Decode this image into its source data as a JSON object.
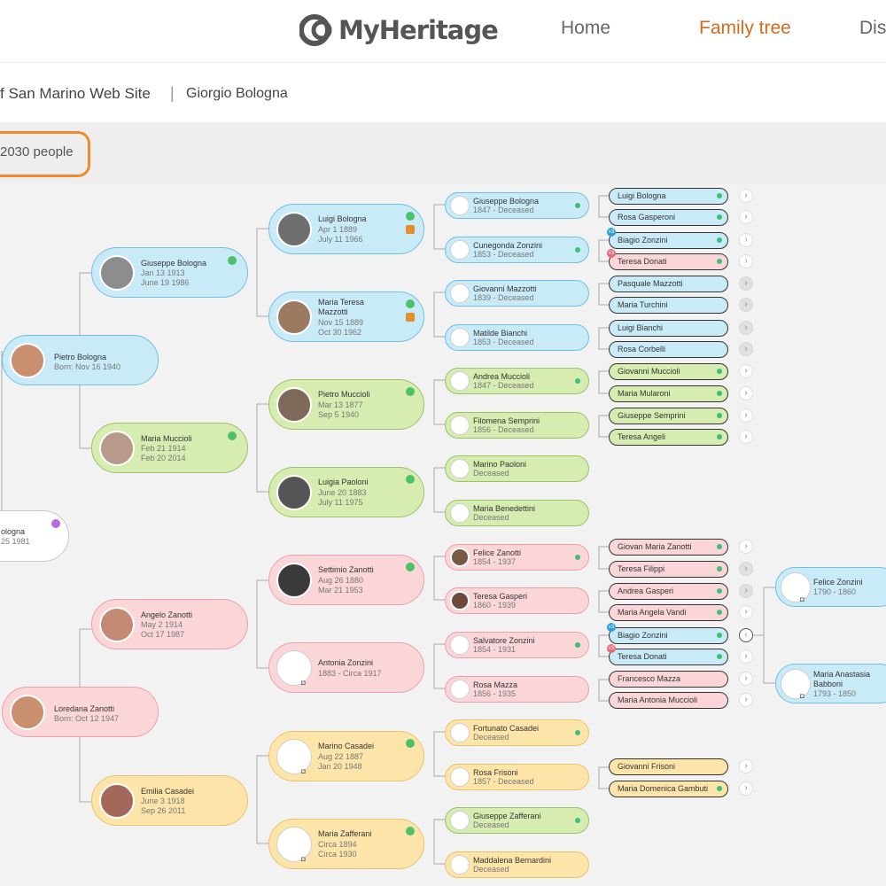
{
  "logo": {
    "text": "MyHeritage",
    "color": "#555555"
  },
  "nav": {
    "home": "Home",
    "family_tree": "Family tree",
    "discover": "Dis"
  },
  "breadcrumb": {
    "site": "f San Marino Web Site",
    "separator": "|",
    "person": "Giorgio Bologna"
  },
  "tree": {
    "people_count": "2030 people"
  },
  "colors": {
    "blue": "#c9ebf8",
    "pink": "#fbd6d9",
    "green": "#d6ecb0",
    "yellow": "#fde5a9",
    "accent": "#d36b1e",
    "highlight": "#f08a2a"
  },
  "root": {
    "name": "ologna",
    "dates": "25 1981"
  },
  "gen1": [
    {
      "name": "Pietro Bologna",
      "d1": "Born: Nov 16 1940",
      "color": "blue"
    },
    {
      "name": "Loredana Zanotti",
      "d1": "Born: Oct 12 1947",
      "color": "pink"
    }
  ],
  "gen2": [
    {
      "name": "Giuseppe Bologna",
      "d1": "Jan 13 1913",
      "d2": "June 19 1986",
      "color": "blue"
    },
    {
      "name": "Maria Muccioli",
      "d1": "Feb 21 1914",
      "d2": "Feb 20 2014",
      "color": "green"
    },
    {
      "name": "Angelo Zanotti",
      "d1": "May 2 1914",
      "d2": "Oct 17 1987",
      "color": "pink"
    },
    {
      "name": "Emilia Casadei",
      "d1": "June 3 1918",
      "d2": "Sep 26 2011",
      "color": "yellow"
    }
  ],
  "gen3": [
    {
      "name": "Luigi Bologna",
      "d1": "Apr 1 1889",
      "d2": "July 11 1966",
      "color": "blue"
    },
    {
      "name": "Maria Teresa",
      "name2": "Mazzotti",
      "d1": "Nov 15 1889",
      "d2": "Oct 30 1962",
      "color": "blue"
    },
    {
      "name": "Pietro Muccioli",
      "d1": "Mar 13 1877",
      "d2": "Sep 5 1940",
      "color": "green"
    },
    {
      "name": "Luigia Paoloni",
      "d1": "June 20 1883",
      "d2": "July 11 1975",
      "color": "green"
    },
    {
      "name": "Settimio Zanotti",
      "d1": "Aug 26 1880",
      "d2": "Mar 21 1953",
      "color": "pink"
    },
    {
      "name": "Antonia Zonzini",
      "d1": "1883 - Circa 1917",
      "d2": "",
      "color": "pink"
    },
    {
      "name": "Marino Casadei",
      "d1": "Aug 22 1887",
      "d2": "Jan 20 1948",
      "color": "yellow"
    },
    {
      "name": "Maria Zafferani",
      "d1": "Circa 1894",
      "d2": "Circa 1930",
      "color": "yellow"
    }
  ],
  "gen4": [
    {
      "name": "Giuseppe Bologna",
      "d1": "1847 - Deceased",
      "color": "blue"
    },
    {
      "name": "Cunegonda Zonzini",
      "d1": "1853 - Deceased",
      "color": "blue"
    },
    {
      "name": "Giovanni Mazzotti",
      "d1": "1839 - Deceased",
      "color": "blue"
    },
    {
      "name": "Matilde Bianchi",
      "d1": "1853 - Deceased",
      "color": "blue"
    },
    {
      "name": "Andrea Muccioli",
      "d1": "1847 - Deceased",
      "color": "green"
    },
    {
      "name": "Filomena Semprini",
      "d1": "1856 - Deceased",
      "color": "green"
    },
    {
      "name": "Marino Paoloni",
      "d1": "Deceased",
      "color": "green"
    },
    {
      "name": "Maria Benedettini",
      "d1": "Deceased",
      "color": "green"
    },
    {
      "name": "Felice Zanotti",
      "d1": "1854 - 1937",
      "color": "pink"
    },
    {
      "name": "Teresa Gasperi",
      "d1": "1860 - 1939",
      "color": "pink"
    },
    {
      "name": "Salvatore Zonzini",
      "d1": "1854 - 1931",
      "color": "pink"
    },
    {
      "name": "Rosa Mazza",
      "d1": "1856 - 1935",
      "color": "pink"
    },
    {
      "name": "Fortunato Casadei",
      "d1": "Deceased",
      "color": "yellow"
    },
    {
      "name": "Rosa Frisoni",
      "d1": "1857 - Deceased",
      "color": "yellow"
    },
    {
      "name": "Giuseppe Zafferani",
      "d1": "Deceased",
      "color": "green"
    },
    {
      "name": "Maddalena Bernardini",
      "d1": "Deceased",
      "color": "yellow"
    }
  ],
  "gen5": [
    {
      "name": "Luigi Bologna",
      "color": "blue"
    },
    {
      "name": "Rosa Gasperoni",
      "color": "blue"
    },
    {
      "name": "Biagio Zonzini",
      "color": "blue",
      "badge": "x3"
    },
    {
      "name": "Teresa Donati",
      "color": "pink",
      "badge": "x3"
    },
    {
      "name": "Pasquale Mazzotti",
      "color": "blue"
    },
    {
      "name": "Maria Turchini",
      "color": "blue"
    },
    {
      "name": "Luigi Bianchi",
      "color": "blue"
    },
    {
      "name": "Rosa Corbelli",
      "color": "blue"
    },
    {
      "name": "Giovanni Muccioli",
      "color": "green"
    },
    {
      "name": "Maria Mularoni",
      "color": "green"
    },
    {
      "name": "Giuseppe Semprini",
      "color": "green"
    },
    {
      "name": "Teresa Angeli",
      "color": "green"
    },
    {
      "name": "Giovan Maria Zanotti",
      "color": "pink"
    },
    {
      "name": "Teresa Filippi",
      "color": "pink"
    },
    {
      "name": "Andrea Gasperi",
      "color": "pink"
    },
    {
      "name": "Maria Angela Vandi",
      "color": "pink"
    },
    {
      "name": "Biagio Zonzini",
      "color": "blue",
      "badge": "x3"
    },
    {
      "name": "Teresa Donati",
      "color": "blue",
      "badge": "x3"
    },
    {
      "name": "Francesco Mazza",
      "color": "pink"
    },
    {
      "name": "Maria Antonia Muccioli",
      "color": "pink"
    },
    {
      "name": "Giovanni Frisoni",
      "color": "yellow"
    },
    {
      "name": "Maria Domenica Gambuti",
      "color": "yellow"
    }
  ],
  "gen6": [
    {
      "name": "Felice Zonzini",
      "d1": "1790 - 1860",
      "color": "blue"
    },
    {
      "name": "Maria Anastasia",
      "name2": "Babboni",
      "d1": "1793 - 1850",
      "color": "blue"
    }
  ],
  "icons": {
    "expand": "chevron-right-icon",
    "collapse": "chevron-left-icon",
    "photo_placeholder": "silhouette-icon",
    "camera": "camera-icon",
    "record_match": "record-match-icon",
    "history": "history-icon"
  }
}
